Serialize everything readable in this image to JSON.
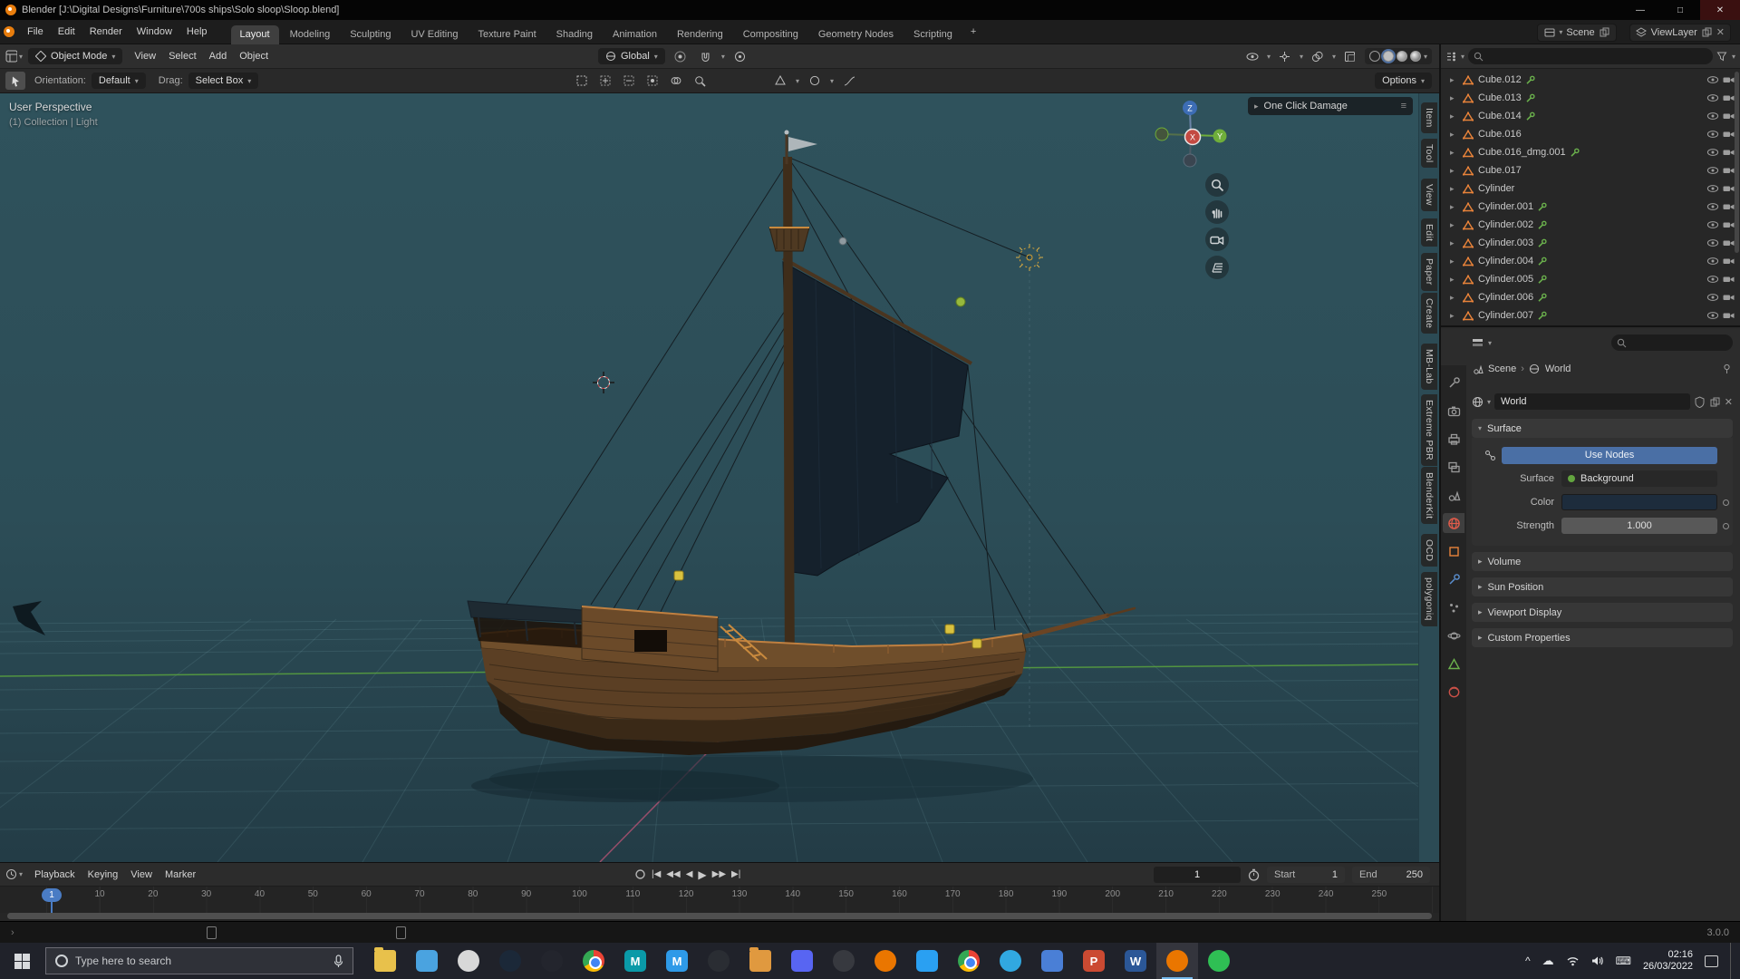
{
  "window": {
    "title": "Blender [J:\\Digital Designs\\Furniture\\700s ships\\Solo sloop\\Sloop.blend]",
    "controls": [
      "—",
      "□",
      "✕"
    ]
  },
  "menubar": {
    "menus": [
      "File",
      "Edit",
      "Render",
      "Window",
      "Help"
    ],
    "workspaces": [
      {
        "label": "Layout",
        "cls": "active"
      },
      {
        "label": "Modeling"
      },
      {
        "label": "Sculpting"
      },
      {
        "label": "UV Editing"
      },
      {
        "label": "Texture Paint"
      },
      {
        "label": "Shading"
      },
      {
        "label": "Animation"
      },
      {
        "label": "Rendering"
      },
      {
        "label": "Compositing"
      },
      {
        "label": "Geometry Nodes"
      },
      {
        "label": "Scripting"
      }
    ],
    "add_workspace": "+",
    "scene_name": "Scene",
    "viewlayer_name": "ViewLayer"
  },
  "viewport_header": {
    "mode": "Object Mode",
    "menus": [
      "View",
      "Select",
      "Add",
      "Object"
    ],
    "orientation": "Global"
  },
  "tool_settings": {
    "orientation_label": "Orientation:",
    "orientation_value": "Default",
    "drag_label": "Drag:",
    "drag_value": "Select Box",
    "options_label": "Options"
  },
  "viewport": {
    "view_label": "User Perspective",
    "collection_label": "(1) Collection | Light",
    "addon_panel_label": "One Click Damage",
    "axis_labels": {
      "x": "X",
      "y": "Y",
      "z": "Z"
    },
    "colors": {
      "bg_top": "#2f525c",
      "bg_bottom": "#233c46",
      "axis_y": "#5aa33e",
      "axis_x": "#c8567a",
      "sail": "#15212c",
      "hull": "#5b3f24"
    }
  },
  "sidebar_tabs": [
    "Item",
    "Tool",
    "View",
    "Edit",
    "Paper",
    "Create",
    "MB-Lab",
    "Extreme PBR",
    "BlenderKit",
    "OCD",
    "polygoniq"
  ],
  "outliner": {
    "items": [
      {
        "name": "Cube.012",
        "mod": true
      },
      {
        "name": "Cube.013",
        "mod": true
      },
      {
        "name": "Cube.014",
        "mod": true
      },
      {
        "name": "Cube.016",
        "mod": false
      },
      {
        "name": "Cube.016_dmg.001",
        "mod": true
      },
      {
        "name": "Cube.017",
        "mod": false
      },
      {
        "name": "Cylinder",
        "mod": false
      },
      {
        "name": "Cylinder.001",
        "mod": true
      },
      {
        "name": "Cylinder.002",
        "mod": true
      },
      {
        "name": "Cylinder.003",
        "mod": true
      },
      {
        "name": "Cylinder.004",
        "mod": true
      },
      {
        "name": "Cylinder.005",
        "mod": true
      },
      {
        "name": "Cylinder.006",
        "mod": true
      },
      {
        "name": "Cylinder.007",
        "mod": true
      }
    ]
  },
  "properties": {
    "breadcrumb_scene": "Scene",
    "breadcrumb_world": "World",
    "datablock_name": "World",
    "surface_panel": "Surface",
    "use_nodes": "Use Nodes",
    "surface_label": "Surface",
    "surface_value": "Background",
    "color_label": "Color",
    "color_value": "#1d2c3c",
    "strength_label": "Strength",
    "strength_value": "1.000",
    "collapsed_panels": [
      "Volume",
      "Sun Position",
      "Viewport Display",
      "Custom Properties"
    ]
  },
  "timeline": {
    "menus": [
      "Playback",
      "Keying",
      "View",
      "Marker"
    ],
    "transport": [
      "|◀",
      "◀◀",
      "◀",
      "▶",
      "▶▶",
      "▶|"
    ],
    "current_frame": "1",
    "start_label": "Start",
    "start_value": "1",
    "end_label": "End",
    "end_value": "250",
    "ticks": [
      "10",
      "20",
      "30",
      "40",
      "50",
      "60",
      "70",
      "80",
      "90",
      "100",
      "110",
      "120",
      "130",
      "140",
      "150",
      "160",
      "170",
      "180",
      "190",
      "200",
      "210",
      "220",
      "230",
      "240",
      "250"
    ]
  },
  "statusbar": {
    "version": "3.0.0"
  },
  "taskbar": {
    "search_placeholder": "Type here to search",
    "icons": [
      {
        "name": "file-explorer",
        "shape": "app-folder",
        "color": "#e8c14b",
        "glyph": ""
      },
      {
        "name": "settings-window",
        "shape": "app-square",
        "color": "#4aa3e0",
        "glyph": ""
      },
      {
        "name": "paint-app",
        "shape": "app-circle",
        "color": "#d8d8d8",
        "glyph": ""
      },
      {
        "name": "steam",
        "shape": "app-circle",
        "color": "#1b2838",
        "glyph": ""
      },
      {
        "name": "obs",
        "shape": "app-circle",
        "color": "#23252d",
        "glyph": ""
      },
      {
        "name": "chrome",
        "shape": "app-chrome",
        "color": "",
        "glyph": ""
      },
      {
        "name": "maya",
        "shape": "app-square",
        "color": "#0a9aa8",
        "glyph": "M"
      },
      {
        "name": "medibang",
        "shape": "app-square",
        "color": "#2e9ae8",
        "glyph": "M"
      },
      {
        "name": "clock-app",
        "shape": "app-circle",
        "color": "#2a2d33",
        "glyph": ""
      },
      {
        "name": "folder-projects",
        "shape": "app-folder",
        "color": "#e0993f",
        "glyph": ""
      },
      {
        "name": "discord",
        "shape": "app-square",
        "color": "#5865f2",
        "glyph": ""
      },
      {
        "name": "dark-app",
        "shape": "app-circle",
        "color": "#37393f",
        "glyph": ""
      },
      {
        "name": "blender",
        "shape": "app-circle",
        "color": "#ea7600",
        "glyph": ""
      },
      {
        "name": "vscode",
        "shape": "app-square",
        "color": "#2aa0f2",
        "glyph": ""
      },
      {
        "name": "chrome-2",
        "shape": "app-chrome",
        "color": "",
        "glyph": ""
      },
      {
        "name": "blue-app",
        "shape": "app-circle",
        "color": "#31a8e0",
        "glyph": ""
      },
      {
        "name": "blue-app-2",
        "shape": "app-square",
        "color": "#4a7fd6",
        "glyph": ""
      },
      {
        "name": "powerpoint",
        "shape": "app-square",
        "color": "#cb4a32",
        "glyph": "P"
      },
      {
        "name": "word",
        "shape": "app-square",
        "color": "#2b5797",
        "glyph": "W"
      },
      {
        "name": "blender-active",
        "shape": "app-circle",
        "color": "#ea7600",
        "glyph": "",
        "state": "active"
      },
      {
        "name": "whatsapp",
        "shape": "app-circle",
        "color": "#2fbf54",
        "glyph": ""
      }
    ],
    "tray_icon_names": [
      "chevron-up-icon",
      "cloud-icon",
      "wifi-icon",
      "volume-icon",
      "keyboard-icon"
    ],
    "time": "02:16",
    "date": "26/03/2022"
  }
}
